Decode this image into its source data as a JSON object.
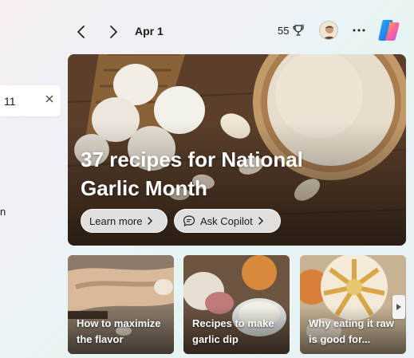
{
  "search": {
    "value": "11"
  },
  "left_fragment": "n",
  "toolbar": {
    "date": "Apr 1",
    "rewards_points": "55"
  },
  "hero": {
    "title": "37 recipes for National Garlic Month",
    "learn_more_label": "Learn more",
    "ask_copilot_label": "Ask Copilot"
  },
  "cards": [
    {
      "label": "How to maximize the flavor"
    },
    {
      "label": "Recipes to make garlic dip"
    },
    {
      "label": "Why eating it raw is good for..."
    }
  ],
  "colors": {
    "accent_bg": "#f6eef4",
    "pill_bg": "#f0f0f0",
    "text": "#1b1b1b"
  },
  "icons": [
    "close-icon",
    "chevron-left-icon",
    "chevron-right-icon",
    "trophy-icon",
    "avatar",
    "more-icon",
    "copilot-logo",
    "chat-icon",
    "chevron-right-small-icon",
    "play-right-icon"
  ]
}
